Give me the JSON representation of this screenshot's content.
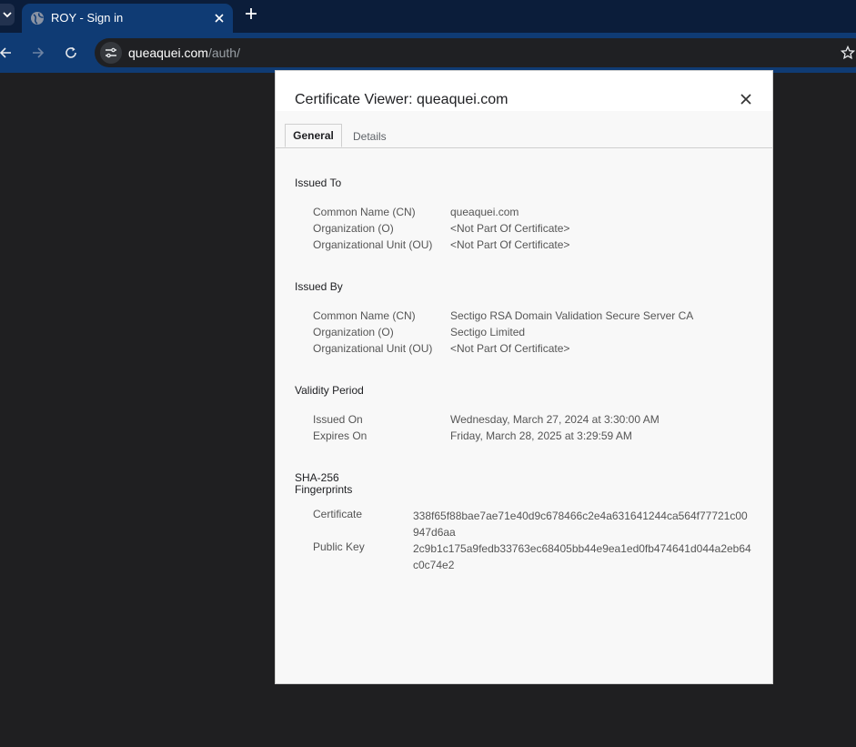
{
  "browser": {
    "tab": {
      "title": "ROY - Sign in",
      "favicon": "globe-icon"
    },
    "address": {
      "host": "queaquei.com",
      "path": "/auth/"
    },
    "colors": {
      "tabbar": "#0b1d3a",
      "toolbar": "#0f3b74",
      "page": "#1f1f21"
    }
  },
  "dialog": {
    "title": "Certificate Viewer: queaquei.com",
    "tabs": {
      "general": "General",
      "details": "Details"
    },
    "issued_to": {
      "heading": "Issued To",
      "rows": [
        {
          "label": "Common Name (CN)",
          "value": "queaquei.com"
        },
        {
          "label": "Organization (O)",
          "value": "<Not Part Of Certificate>"
        },
        {
          "label": "Organizational Unit (OU)",
          "value": "<Not Part Of Certificate>"
        }
      ]
    },
    "issued_by": {
      "heading": "Issued By",
      "rows": [
        {
          "label": "Common Name (CN)",
          "value": "Sectigo RSA Domain Validation Secure Server CA"
        },
        {
          "label": "Organization (O)",
          "value": "Sectigo Limited"
        },
        {
          "label": "Organizational Unit (OU)",
          "value": "<Not Part Of Certificate>"
        }
      ]
    },
    "validity": {
      "heading": "Validity Period",
      "rows": [
        {
          "label": "Issued On",
          "value": "Wednesday, March 27, 2024 at 3:30:00 AM"
        },
        {
          "label": "Expires On",
          "value": "Friday, March 28, 2025 at 3:29:59 AM"
        }
      ]
    },
    "fingerprints": {
      "heading_line1": "SHA-256",
      "heading_line2": "Fingerprints",
      "rows": [
        {
          "label": "Certificate",
          "value": "338f65f88bae7ae71e40d9c678466c2e4a631641244ca564f77721c00947d6aa"
        },
        {
          "label": "Public Key",
          "value": "2c9b1c175a9fedb33763ec68405bb44e9ea1ed0fb474641d044a2eb64c0c74e2"
        }
      ]
    }
  }
}
